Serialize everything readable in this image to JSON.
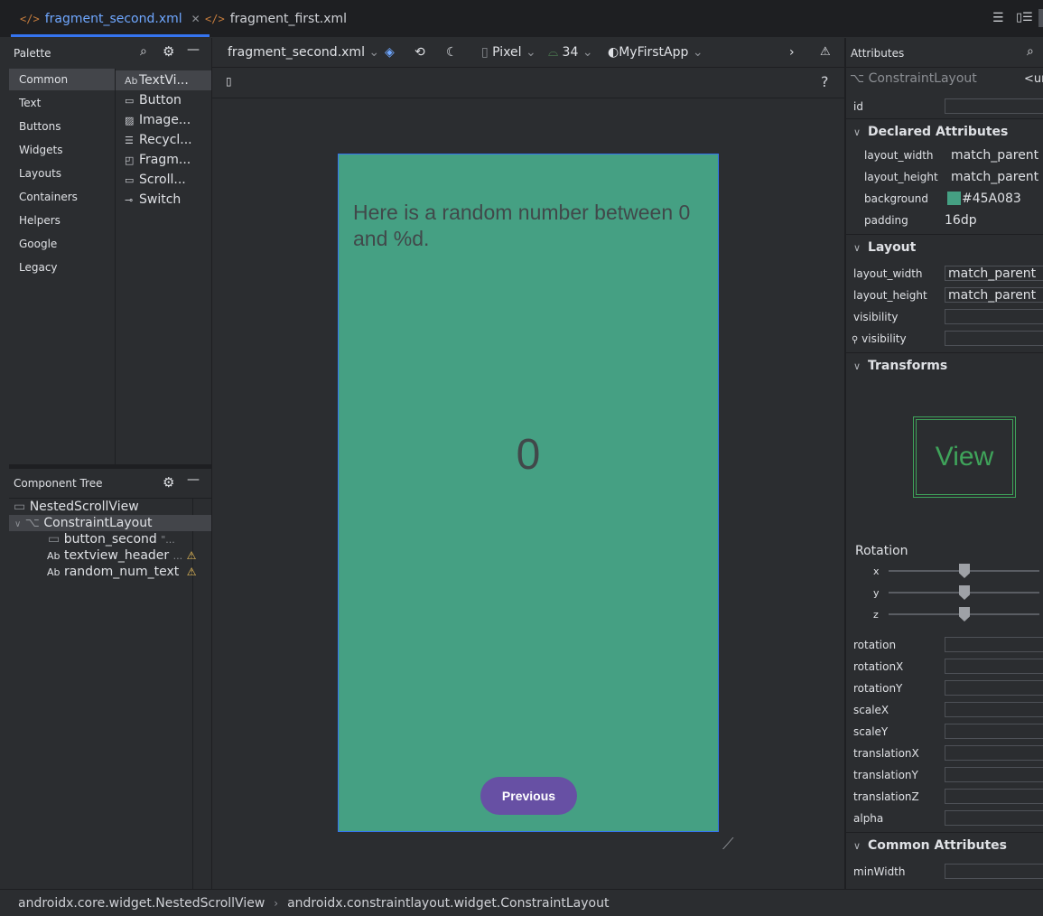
{
  "tabs": [
    {
      "label": "fragment_second.xml",
      "active": true,
      "close": "✕"
    },
    {
      "label": "fragment_first.xml",
      "active": false
    }
  ],
  "palette": {
    "title": "Palette",
    "categories": [
      "Common",
      "Text",
      "Buttons",
      "Widgets",
      "Layouts",
      "Containers",
      "Helpers",
      "Google",
      "Legacy"
    ],
    "selected_category": "Common",
    "items": [
      {
        "icon": "Ab",
        "label": "TextVi..."
      },
      {
        "icon": "▭",
        "label": "Button"
      },
      {
        "icon": "▨",
        "label": "Image..."
      },
      {
        "icon": "☰",
        "label": "Recycl..."
      },
      {
        "icon": "◰",
        "label": "Fragm..."
      },
      {
        "icon": "▭",
        "label": "Scroll..."
      },
      {
        "icon": "⊸",
        "label": "Switch"
      }
    ]
  },
  "component_tree": {
    "title": "Component Tree",
    "nodes": [
      {
        "icon": "▭",
        "label": "NestedScrollView",
        "suffix": ""
      },
      {
        "icon": "⌥",
        "label": "ConstraintLayout",
        "suffix": ""
      },
      {
        "icon": "▭",
        "label": "button_second",
        "suffix": "\"..."
      },
      {
        "icon": "Ab",
        "label": "textview_header",
        "suffix": "..."
      },
      {
        "icon": "Ab",
        "label": "random_num_text",
        "suffix": ""
      }
    ]
  },
  "toolbar": {
    "file": "fragment_second.xml",
    "device": "Pixel",
    "api": "34",
    "theme": "MyFirstApp",
    "help": "?"
  },
  "preview": {
    "header_text": "Here is a random number between 0 and %d.",
    "number": "0",
    "button_label": "Previous"
  },
  "attributes": {
    "title": "Attributes",
    "component": "ConstraintLayout",
    "component_extra": "<ur",
    "id_label": "id",
    "declared_title": "Declared Attributes",
    "declared": [
      {
        "key": "layout_width",
        "value": "match_parent"
      },
      {
        "key": "layout_height",
        "value": "match_parent"
      },
      {
        "key": "background",
        "value": "#45A083"
      },
      {
        "key": "padding",
        "value": "16dp"
      }
    ],
    "layout_title": "Layout",
    "layout": [
      {
        "key": "layout_width",
        "value": "match_parent"
      },
      {
        "key": "layout_height",
        "value": "match_parent"
      },
      {
        "key": "visibility",
        "value": ""
      },
      {
        "key": "visibility",
        "value": ""
      }
    ],
    "transforms_title": "Transforms",
    "view_preview": "View",
    "rotation_label": "Rotation",
    "axes": [
      "x",
      "y",
      "z"
    ],
    "transform_fields": [
      "rotation",
      "rotationX",
      "rotationY",
      "scaleX",
      "scaleY",
      "translationX",
      "translationY",
      "translationZ",
      "alpha"
    ],
    "common_title": "Common Attributes",
    "common_fields": [
      "minWidth"
    ]
  },
  "breadcrumb": [
    "androidx.core.widget.NestedScrollView",
    "androidx.constraintlayout.widget.ConstraintLayout"
  ],
  "colors": {
    "background_swatch": "#45A083",
    "button": "#6750a4",
    "accent": "#3574f0"
  }
}
